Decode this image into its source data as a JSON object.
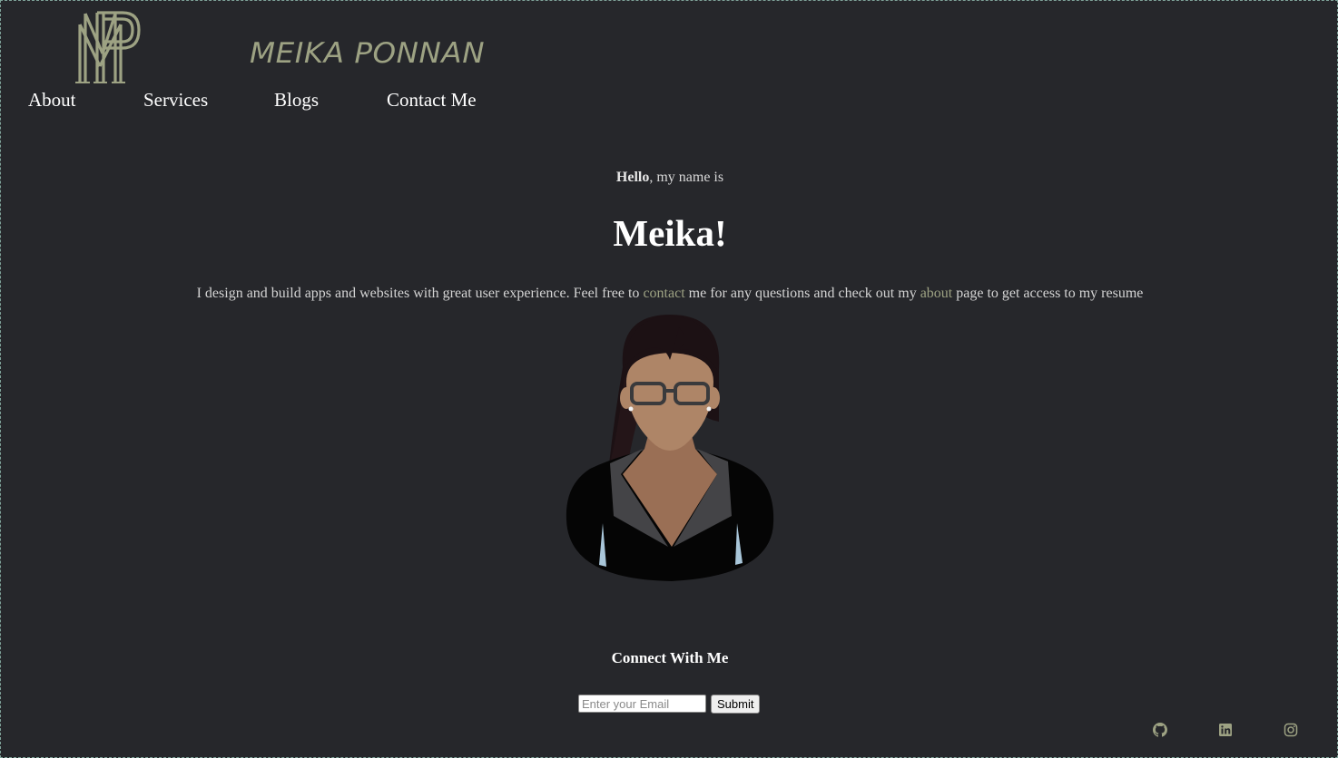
{
  "header": {
    "logo": {
      "icon": "mp-monogram-logo",
      "color": "#9da283"
    },
    "brand_name": "MEIKA PONNAN"
  },
  "nav": {
    "items": [
      {
        "label": "About"
      },
      {
        "label": "Services"
      },
      {
        "label": "Blogs"
      },
      {
        "label": "Contact Me"
      }
    ]
  },
  "hero": {
    "greeting_bold": "Hello",
    "greeting_rest": ", my name is",
    "name": "Meika!",
    "intro_part1": "I design and build apps and websites with great user experience. Feel free to ",
    "contact_link": "contact",
    "intro_part2": " me for any questions and check out my ",
    "about_link": "about",
    "intro_part3": " page to get access to my resume",
    "avatar_icon": "woman-avatar-illustration"
  },
  "connect": {
    "title": "Connect With Me",
    "email_placeholder": "Enter your Email",
    "submit_label": "Submit"
  },
  "social": [
    {
      "icon": "github-icon"
    },
    {
      "icon": "linkedin-icon"
    },
    {
      "icon": "instagram-icon"
    }
  ],
  "colors": {
    "background": "#26272b",
    "accent": "#9da283",
    "text": "#ffffff"
  }
}
